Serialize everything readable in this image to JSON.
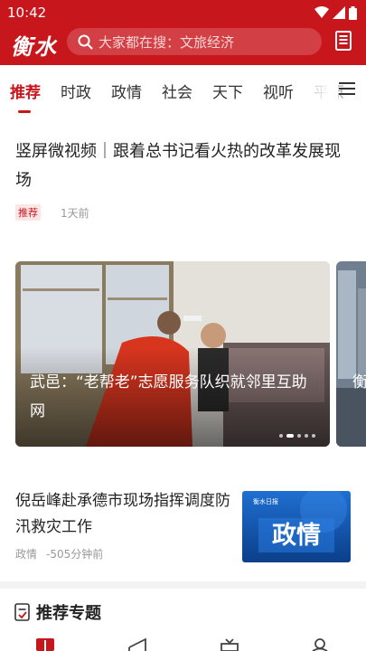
{
  "status": {
    "time": "10:42"
  },
  "app": {
    "logo": "衡水",
    "search_placeholder": "大家都在搜：文旅经济"
  },
  "tabs": [
    {
      "label": "推荐",
      "active": true
    },
    {
      "label": "时政"
    },
    {
      "label": "政情"
    },
    {
      "label": "社会"
    },
    {
      "label": "天下"
    },
    {
      "label": "视听"
    },
    {
      "label": "平原"
    }
  ],
  "feed": {
    "article1": {
      "title": "竖屏微视频｜跟着总书记看火热的改革发展现场",
      "tag": "推荐",
      "time": "1天前"
    },
    "carousel": {
      "caption": "武邑：“老帮老”志愿服务队织就邻里互助网",
      "next_caption": "衡水心",
      "dots": 5,
      "active_dot": 1
    },
    "article2": {
      "title": "倪岳峰赴承德市现场指挥调度防汛救灾工作",
      "category": "政情",
      "time": "-505分钟前",
      "thumb_text": "政情",
      "thumb_logo": "衡水日报"
    }
  },
  "section": {
    "title": "推荐专题"
  },
  "colors": {
    "brand": "#c8161d"
  }
}
